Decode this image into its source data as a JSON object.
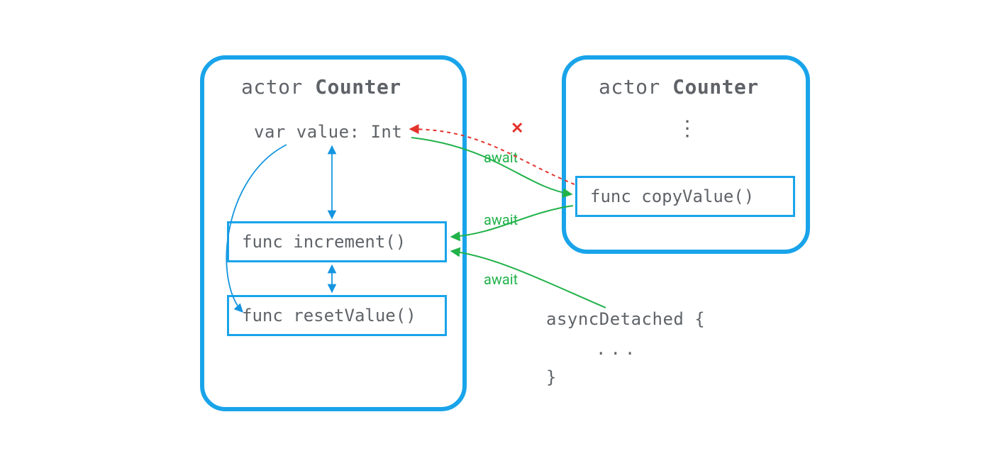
{
  "colors": {
    "box_blue": "#19a4ea",
    "arrow_blue": "#1595e0",
    "arrow_green": "#21b24a",
    "arrow_red": "#e4322b",
    "text_gray": "#5f6368"
  },
  "left_actor": {
    "title_prefix": "actor ",
    "title_name": "Counter",
    "var_line": "var value: Int",
    "func1": "func increment()",
    "func2": "func resetValue()"
  },
  "right_actor": {
    "title_prefix": "actor ",
    "title_name": "Counter",
    "ellipsis": "⋮",
    "func1": "func copyValue()"
  },
  "await_labels": {
    "a1": "await",
    "a2": "await",
    "a3": "await"
  },
  "code_block": {
    "line1": "asyncDetached {",
    "line2": "...",
    "line3": "}"
  },
  "cross_mark": "✕"
}
